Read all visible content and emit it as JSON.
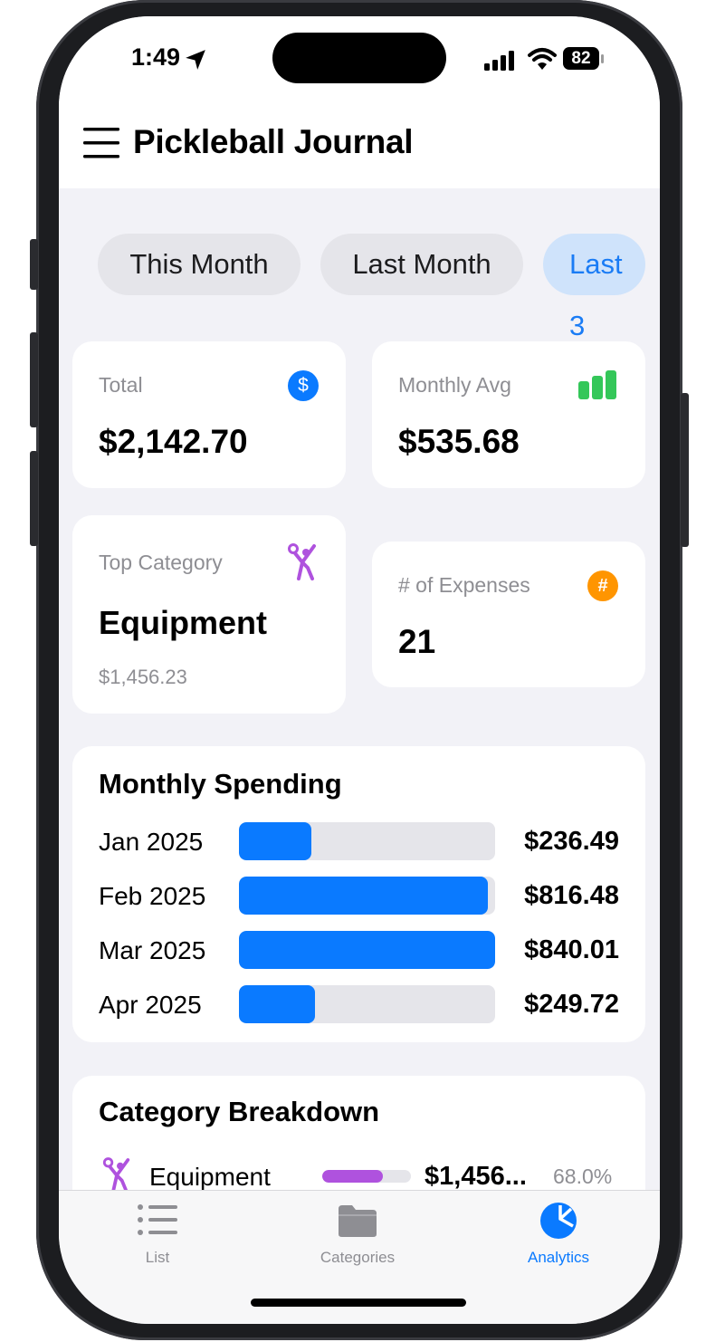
{
  "status_bar": {
    "time": "1:49",
    "battery": "82"
  },
  "app": {
    "title": "Pickleball Journal"
  },
  "filters": {
    "items": [
      "This Month",
      "Last Month",
      "Last 3"
    ],
    "selected": "Last 3"
  },
  "cards": {
    "total": {
      "label": "Total",
      "value": "$2,142.70",
      "icon": "dollar-icon"
    },
    "monthly_avg": {
      "label": "Monthly Avg",
      "value": "$535.68",
      "icon": "bar-chart-icon"
    },
    "top_category": {
      "label": "Top Category",
      "value": "Equipment",
      "sub": "$1,456.23",
      "icon": "pickleball-player-icon"
    },
    "expenses": {
      "label": "# of Expenses",
      "value": "21",
      "icon": "hash-icon"
    }
  },
  "monthly_spending": {
    "title": "Monthly Spending",
    "rows": [
      {
        "month": "Jan 2025",
        "amount": "$236.49",
        "fraction": 0.2815
      },
      {
        "month": "Feb 2025",
        "amount": "$816.48",
        "fraction": 0.972
      },
      {
        "month": "Mar 2025",
        "amount": "$840.01",
        "fraction": 1.0
      },
      {
        "month": "Apr 2025",
        "amount": "$249.72",
        "fraction": 0.2973
      }
    ]
  },
  "category_breakdown": {
    "title": "Category Breakdown",
    "rows": [
      {
        "name": "Equipment",
        "amount": "$1,456...",
        "percent": "68.0%",
        "fraction": 0.68
      }
    ]
  },
  "tab_bar": {
    "items": [
      {
        "label": "List",
        "icon": "list-icon"
      },
      {
        "label": "Categories",
        "icon": "folder-icon"
      },
      {
        "label": "Analytics",
        "icon": "pie-chart-icon"
      }
    ],
    "selected": "Analytics"
  },
  "colors": {
    "accent": "#0a7aff",
    "green": "#34c759",
    "orange": "#ff9500",
    "purple": "#af52de"
  }
}
